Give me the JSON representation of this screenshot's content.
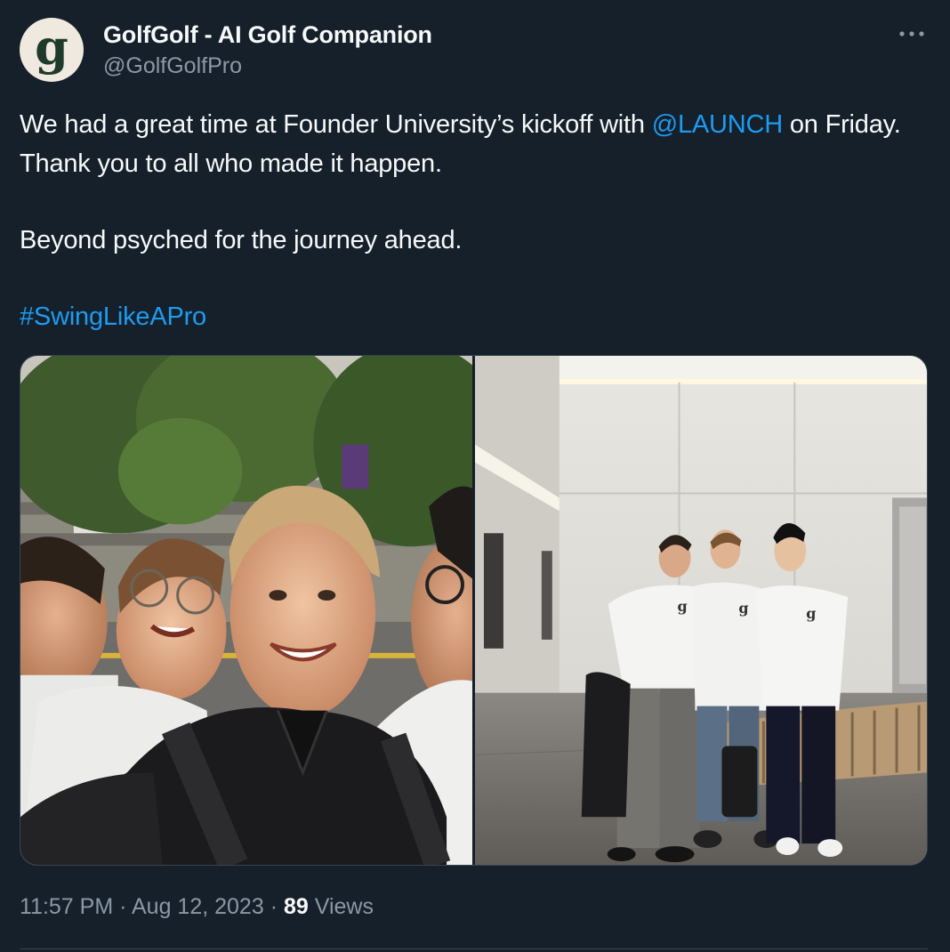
{
  "author": {
    "name": "GolfGolf - AI Golf Companion",
    "handle": "@GolfGolfPro",
    "avatar_icon": "golfgolf-g-logo-icon",
    "avatar_letter": "g"
  },
  "menu": {
    "more_icon": "more-dots-icon"
  },
  "tweet": {
    "line1_before": "We had a great time at Founder University’s kickoff with ",
    "mention": "@LAUNCH",
    "line1_after": " on Friday. Thank you to all who made it happen.",
    "line2": "Beyond psyched for the journey ahead.",
    "hashtag": "#SwingLikeAPro"
  },
  "media": {
    "photos": [
      {
        "name": "group-selfie-street-photo"
      },
      {
        "name": "team-in-lobby-photo"
      }
    ]
  },
  "meta": {
    "time": "11:57 PM",
    "separator": " · ",
    "date": "Aug 12, 2023",
    "views_count": "89",
    "views_label": " Views"
  },
  "colors": {
    "background": "#15202b",
    "text": "#f7f9f9",
    "secondary": "#8b98a5",
    "link": "#1d9bf0",
    "border": "#38444d"
  }
}
